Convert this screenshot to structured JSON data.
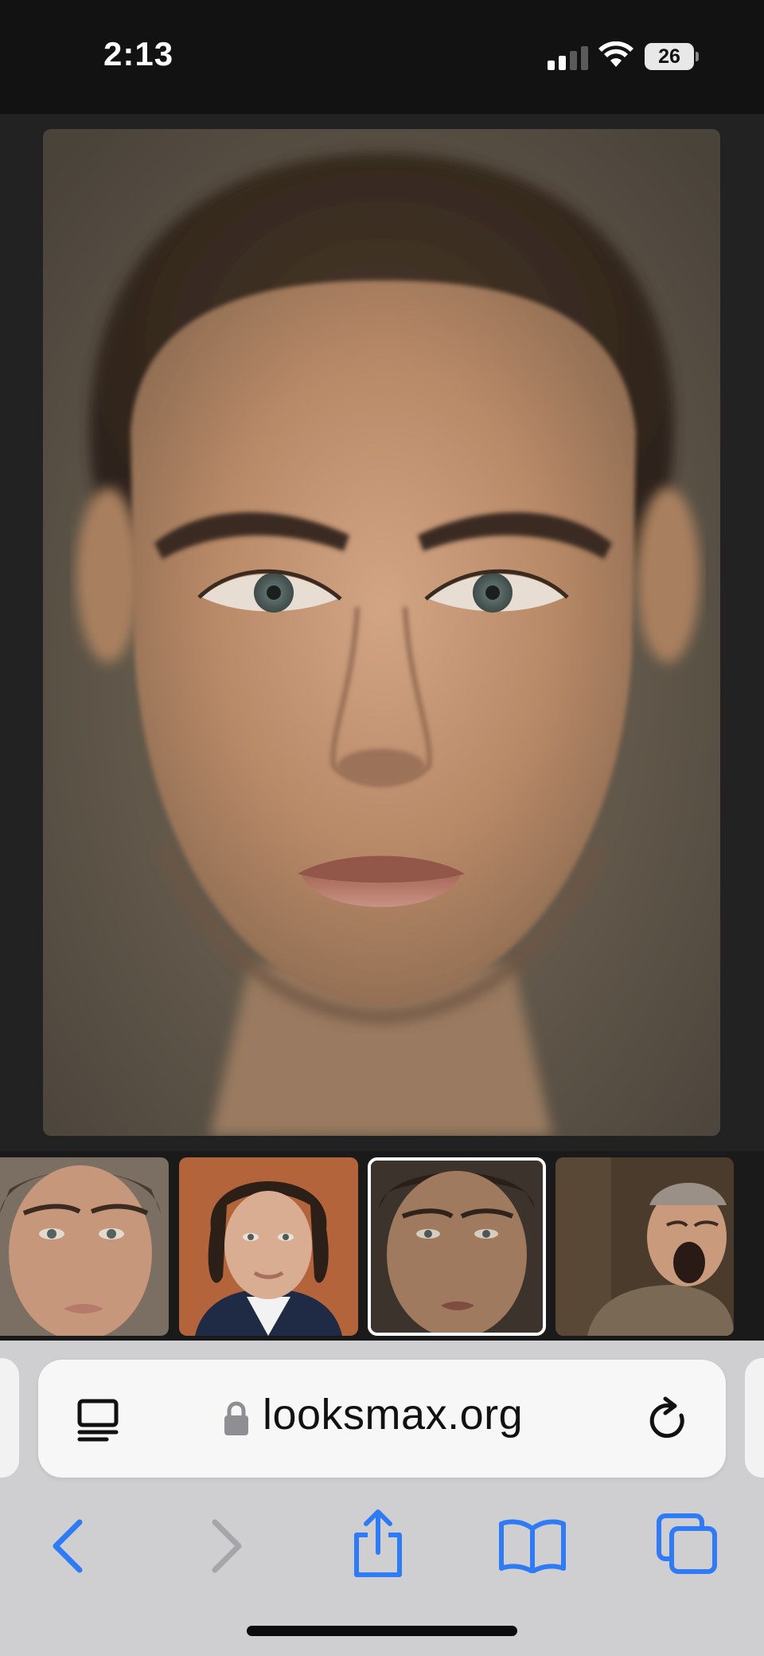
{
  "status_bar": {
    "time": "2:13",
    "battery_level": "26",
    "signal_bars_active": 2,
    "signal_bars_total": 4
  },
  "viewer": {
    "main_image_icon": "face-portrait"
  },
  "thumbnails": [
    {
      "icon": "face-thumbnail",
      "selected": false
    },
    {
      "icon": "face-thumbnail",
      "selected": false
    },
    {
      "icon": "face-thumbnail",
      "selected": true
    },
    {
      "icon": "face-thumbnail",
      "selected": false
    }
  ],
  "browser": {
    "url": "looksmax.org",
    "accent_color": "#2f7bf5",
    "disabled_color": "#a5a5aa"
  }
}
